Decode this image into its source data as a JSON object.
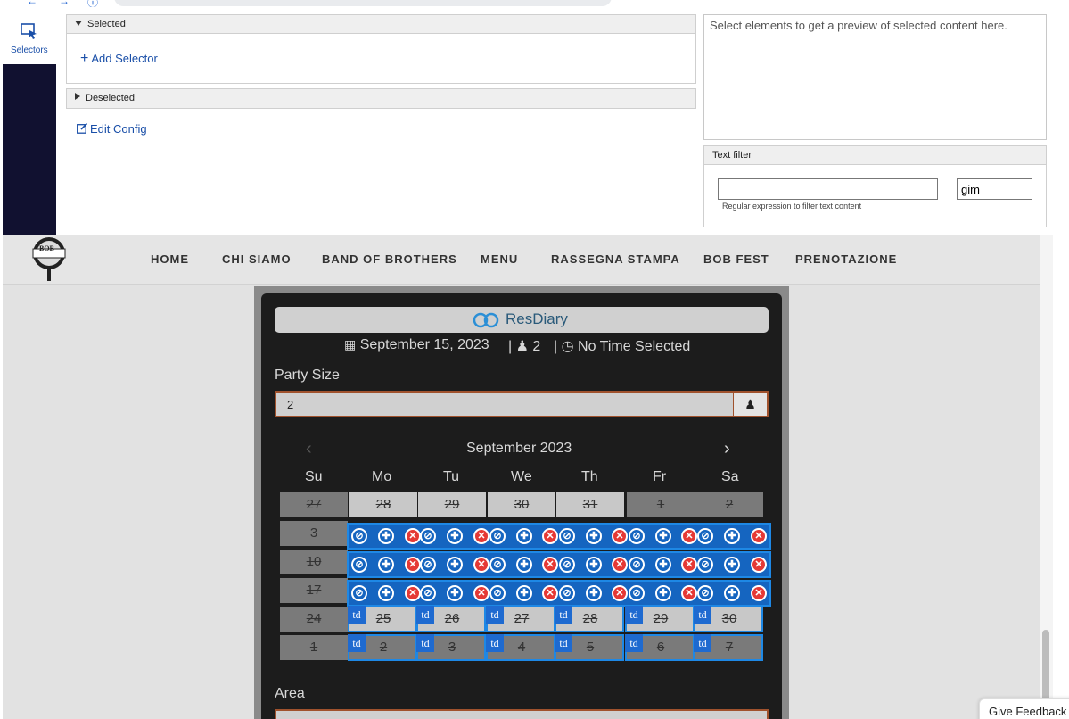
{
  "browser": {
    "icons": [
      "back-icon",
      "forward-icon",
      "info-icon",
      "lock-icon"
    ]
  },
  "extension": {
    "sidebar_label": "Selectors",
    "selected_header": "Selected",
    "add_selector": "Add Selector",
    "deselected_header": "Deselected",
    "edit_config": "Edit Config",
    "preview_placeholder": "Select elements to get a preview of selected content here.",
    "text_filter_header": "Text filter",
    "filter_input_value": "",
    "filter_right_value": "gim",
    "filter_hint": "Regular expression to filter text content"
  },
  "site": {
    "logo_text": "BOB",
    "nav": [
      "HOME",
      "CHI SIAMO",
      "BAND OF BROTHERS",
      "MENU",
      "RASSEGNA STAMPA",
      "BOB FEST",
      "PRENOTAZIONE"
    ]
  },
  "widget": {
    "brand": "ResDiary",
    "date": "September 15, 2023",
    "party_count": "2",
    "time": "No Time Selected",
    "party_label": "Party Size",
    "party_value": "2",
    "month": "September 2023",
    "weekdays": [
      "Su",
      "Mo",
      "Tu",
      "We",
      "Th",
      "Fr",
      "Sa"
    ],
    "week1": [
      "27",
      "28",
      "29",
      "30",
      "31",
      "1",
      "2"
    ],
    "first_col": [
      "3",
      "10",
      "17",
      "24",
      "1"
    ],
    "week5": [
      "25",
      "26",
      "27",
      "28",
      "29",
      "30"
    ],
    "week6": [
      "2",
      "3",
      "4",
      "5",
      "6",
      "7"
    ],
    "area_label": "Area"
  },
  "overlay": {
    "td_label": "td"
  },
  "feedback": "Give Feedback",
  "colors": {
    "accent": "#1565c0",
    "remove": "#e53935",
    "nav_dark": "#111130"
  }
}
